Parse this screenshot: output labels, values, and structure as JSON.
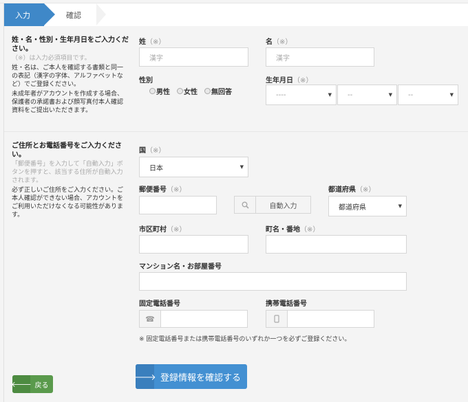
{
  "steps": [
    {
      "label": "入力",
      "active": true
    },
    {
      "label": "確認",
      "active": false
    }
  ],
  "section1": {
    "title": "姓・名・性別・生年月日をご入力ください。",
    "required_note": "（※）は入力必須項目です。",
    "paragraph1": "姓・名は、ご本人を確認する書類と同一の表記（漢字の字体、アルファベットなど）でご登録ください。",
    "paragraph2": "未成年者がアカウントを作成する場合、保護者の承諾書および顔写真付本人確認資料をご提出いただきます。",
    "last_name": {
      "label": "姓",
      "req": "（※）",
      "placeholder": "漢字",
      "value": ""
    },
    "first_name": {
      "label": "名",
      "req": "（※）",
      "placeholder": "漢字",
      "value": ""
    },
    "gender": {
      "label": "性別",
      "options": [
        "男性",
        "女性",
        "無回答"
      ],
      "selected": null
    },
    "birthdate": {
      "label": "生年月日",
      "req": "（※）",
      "year": "----",
      "month": "--",
      "day": "--"
    }
  },
  "section2": {
    "title": "ご住所とお電話番号をご入力ください。",
    "note": "「郵便番号」を入力して「自動入力」ボタンを押すと、該当する住所が自動入力されます。",
    "paragraph": "必ず正しいご住所をご入力ください。ご本人確認ができない場合、アカウントをご利用いただけなくなる可能性があります。",
    "country": {
      "label": "国",
      "req": "（※）",
      "value": "日本"
    },
    "postal": {
      "label": "郵便番号",
      "req": "（※）",
      "value": "",
      "auto_label": "自動入力"
    },
    "prefecture": {
      "label": "都道府県",
      "req": "（※）",
      "value": "都道府県"
    },
    "city": {
      "label": "市区町村",
      "req": "（※）",
      "value": ""
    },
    "street": {
      "label": "町名・番地",
      "req": "（※）",
      "value": ""
    },
    "building": {
      "label": "マンション名・お部屋番号",
      "value": ""
    },
    "landline": {
      "label": "固定電話番号",
      "value": "",
      "icon": "phone-icon"
    },
    "mobile": {
      "label": "携帯電話番号",
      "value": "",
      "icon": "mobile-icon"
    },
    "footnote": "※ 固定電話番号または携帯電話番号のいずれか一つを必ずご登録ください。"
  },
  "buttons": {
    "back": "戻る",
    "confirm": "登録情報を確認する"
  },
  "colors": {
    "primary": "#4390d2",
    "step_active": "#3f88c8",
    "back": "#5a9a4c"
  }
}
